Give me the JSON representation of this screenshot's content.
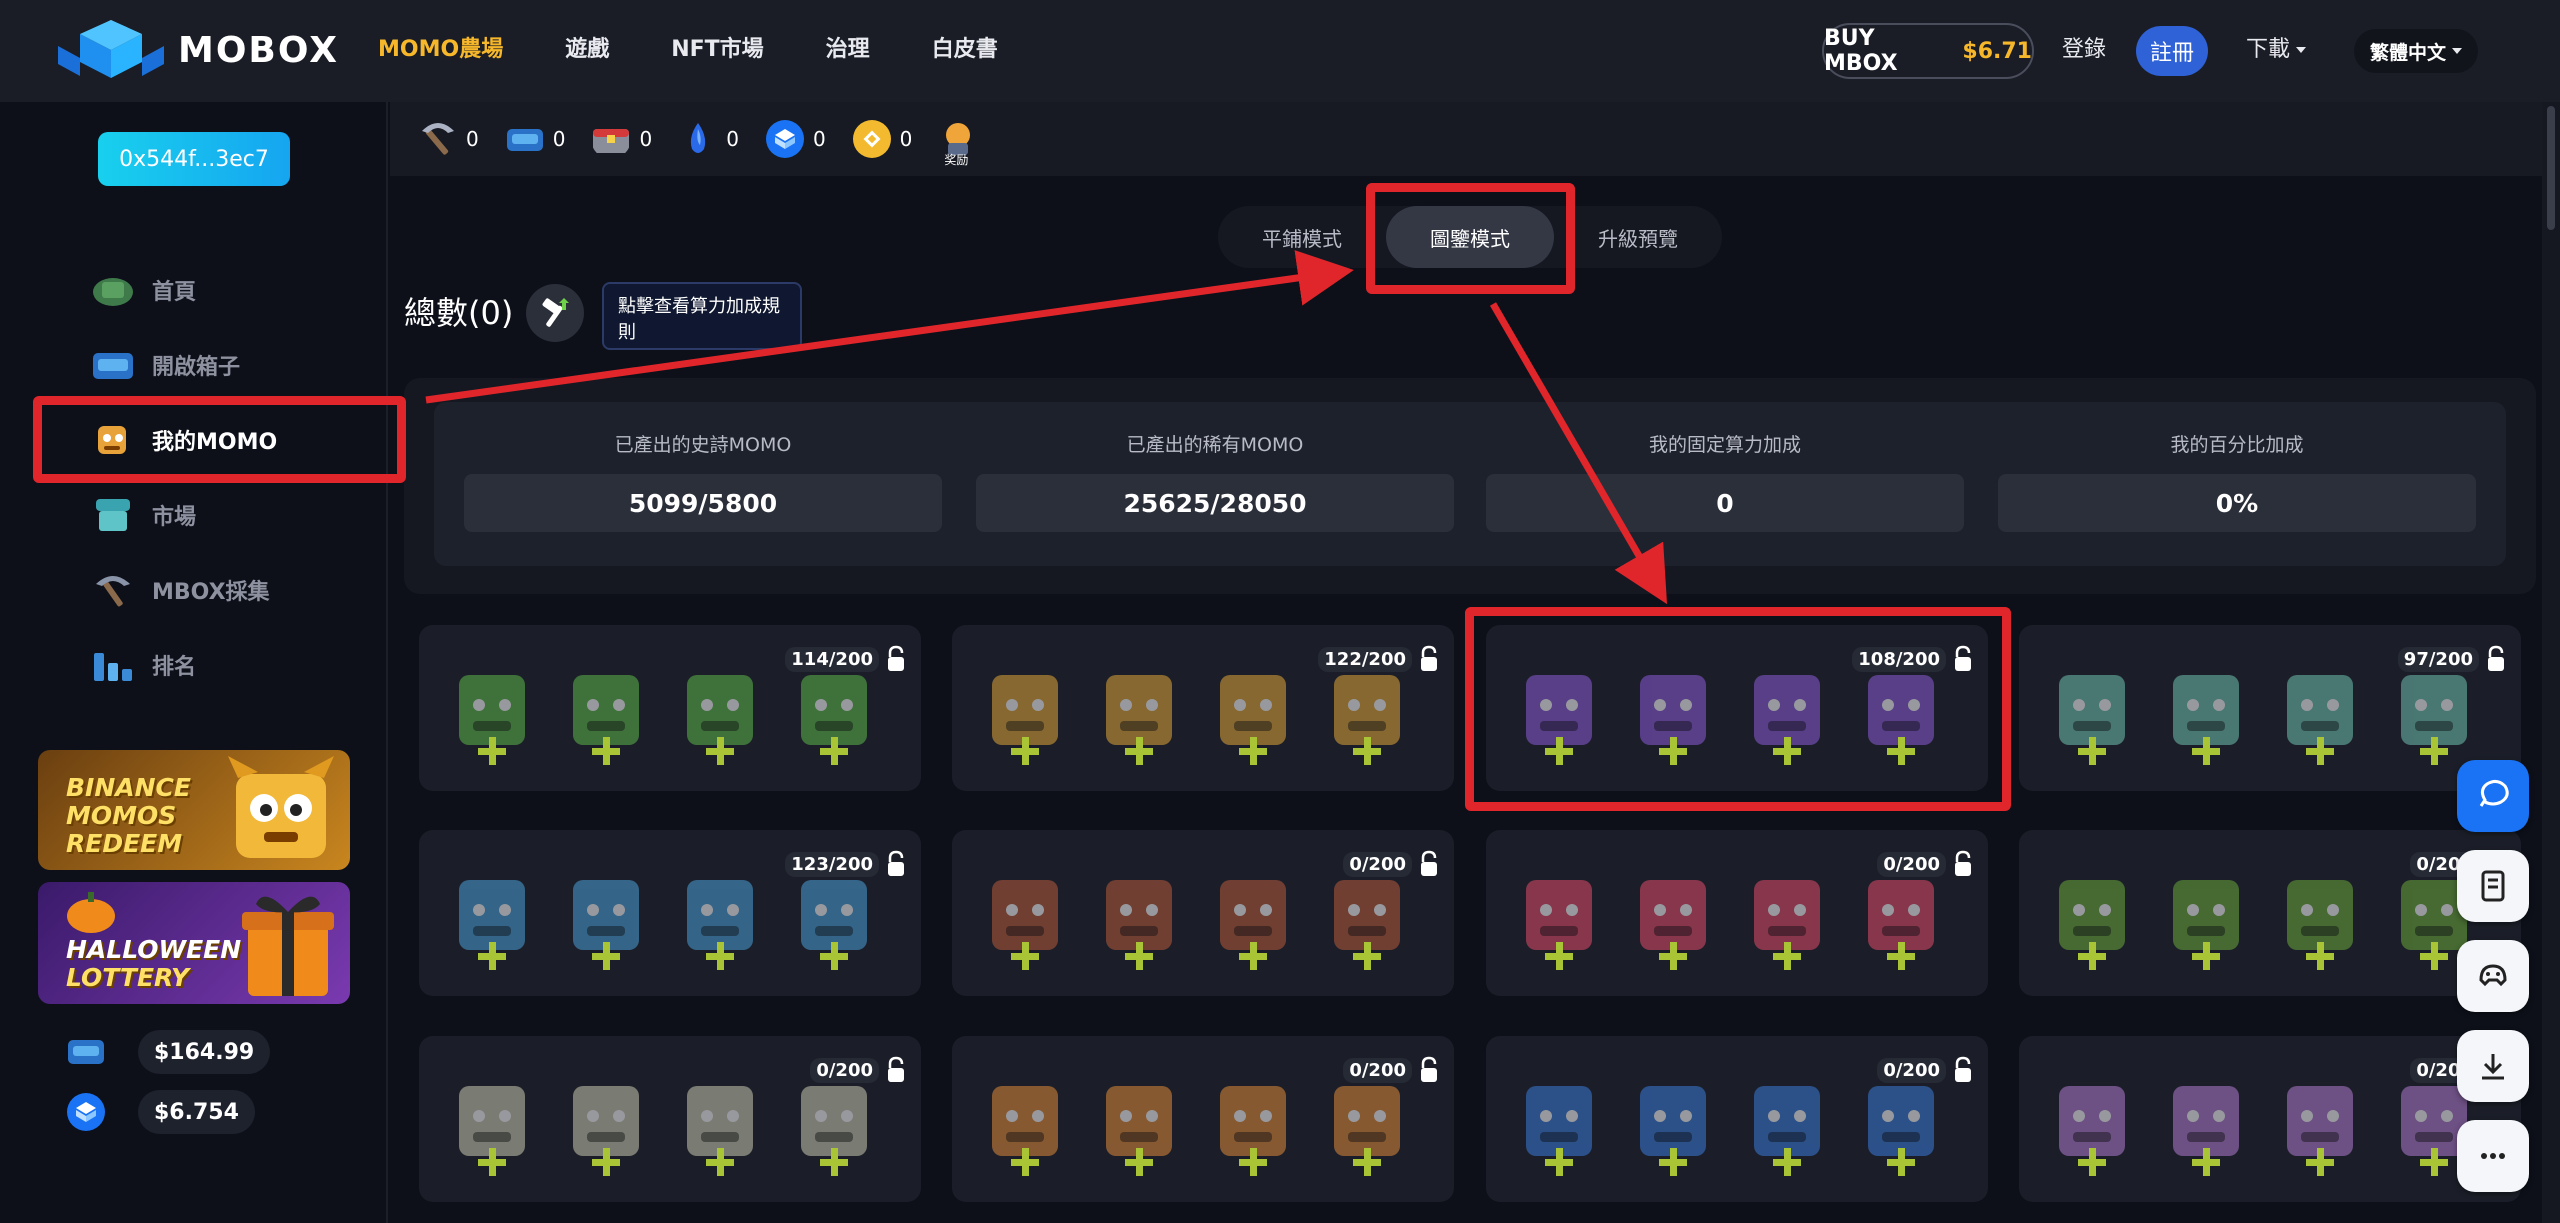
{
  "brand": {
    "name": "MOBOX"
  },
  "nav": {
    "items": [
      "MOMO農場",
      "遊戲",
      "NFT市場",
      "治理",
      "白皮書"
    ],
    "buy_label": "BUY MBOX",
    "buy_price": "$6.71",
    "login": "登錄",
    "register": "註冊",
    "download": "下載",
    "language": "繁體中文"
  },
  "sidebar": {
    "wallet": "0x544f...3ec7",
    "items": [
      {
        "label": "首頁",
        "icon": "home-icon"
      },
      {
        "label": "開啟箱子",
        "icon": "box-icon"
      },
      {
        "label": "我的MOMO",
        "icon": "momo-icon"
      },
      {
        "label": "市場",
        "icon": "market-icon"
      },
      {
        "label": "MBOX採集",
        "icon": "pickaxe-icon"
      },
      {
        "label": "排名",
        "icon": "ranking-icon"
      }
    ],
    "banners": [
      {
        "lines": [
          "BINANCE",
          "MOMOS",
          "REDEEM"
        ]
      },
      {
        "lines": [
          "HALLOWEEN",
          "LOTTERY"
        ]
      }
    ],
    "balances": [
      {
        "icon": "box-token-icon",
        "value": "$164.99"
      },
      {
        "icon": "mbox-token-icon",
        "value": "$6.754"
      }
    ]
  },
  "tokens": [
    {
      "icon": "key-icon",
      "value": "0"
    },
    {
      "icon": "box-icon",
      "value": "0"
    },
    {
      "icon": "chest-icon",
      "value": "0"
    },
    {
      "icon": "crystal-icon",
      "value": "0"
    },
    {
      "icon": "mbox-icon",
      "value": "0"
    },
    {
      "icon": "bnb-icon",
      "value": "0"
    },
    {
      "icon": "bonus-icon",
      "label": "奖励"
    }
  ],
  "tabs": [
    "平鋪模式",
    "圖鑒模式",
    "升級預覽"
  ],
  "total_label": "總數(0)",
  "tooltip": "點擊查看算力加成規則",
  "stats": [
    {
      "label": "已產出的史詩MOMO",
      "value": "5099/5800"
    },
    {
      "label": "已產出的稀有MOMO",
      "value": "25625/28050"
    },
    {
      "label": "我的固定算力加成",
      "value": "0"
    },
    {
      "label": "我的百分比加成",
      "value": "0%"
    }
  ],
  "cards": [
    {
      "count": "114/200",
      "color": "#5db84a"
    },
    {
      "count": "122/200",
      "color": "#e0a53a"
    },
    {
      "count": "108/200",
      "color": "#8a5ad8"
    },
    {
      "count": "97/200",
      "color": "#6fc0b0"
    },
    {
      "count": "123/200",
      "color": "#4aa0d8"
    },
    {
      "count": "0/200",
      "color": "#b65a3a"
    },
    {
      "count": "0/200",
      "color": "#e04a6a"
    },
    {
      "count": "0/200",
      "color": "#6aa83a"
    },
    {
      "count": "0/200",
      "color": "#c8c8b0"
    },
    {
      "count": "0/200",
      "color": "#e08a3a"
    },
    {
      "count": "0/200",
      "color": "#3a7ad8"
    },
    {
      "count": "0/200",
      "color": "#b07ad0"
    }
  ],
  "fabs": [
    "chat-icon",
    "news-icon",
    "game-icon",
    "download-icon",
    "more-icon"
  ],
  "colors": {
    "accent": "#f6b72a",
    "annotation": "#e0262b",
    "primary": "#1a73f4"
  }
}
